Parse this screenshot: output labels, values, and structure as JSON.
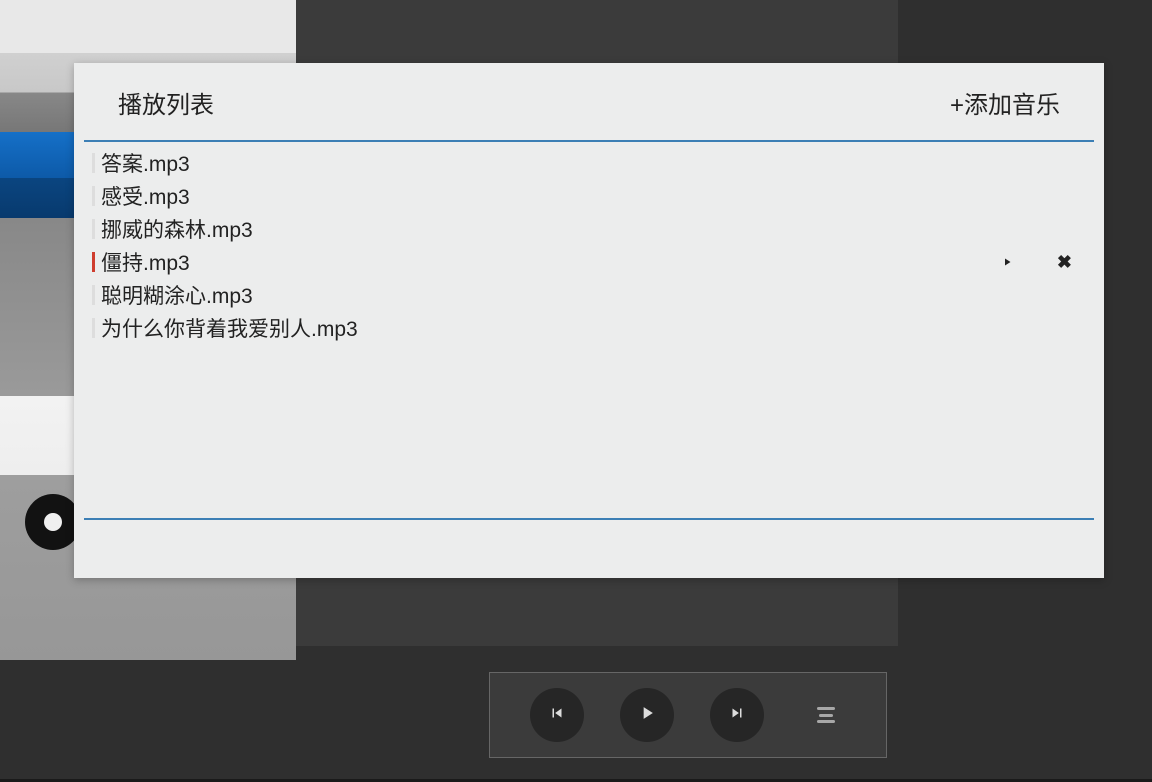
{
  "playlist": {
    "title": "播放列表",
    "add_label": "+添加音乐",
    "items": [
      {
        "label": "答案.mp3",
        "active": false
      },
      {
        "label": "感受.mp3",
        "active": false
      },
      {
        "label": "挪威的森林.mp3",
        "active": false
      },
      {
        "label": "僵持.mp3",
        "active": true
      },
      {
        "label": "聪明糊涂心.mp3",
        "active": false
      },
      {
        "label": "为什么你背着我爱别人.mp3",
        "active": false
      }
    ]
  },
  "colors": {
    "panel_bg": "#eceded",
    "rule": "#3c7fb5",
    "active_marker": "#cf3d2e",
    "app_bg": "#2f2f2f",
    "ctrl_bg": "#262626"
  }
}
